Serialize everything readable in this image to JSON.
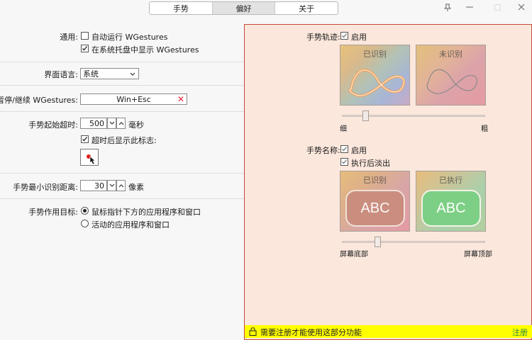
{
  "tabs": [
    {
      "label": "手势",
      "active": false
    },
    {
      "label": "偏好",
      "active": true
    },
    {
      "label": "关于",
      "active": false
    }
  ],
  "left": {
    "general_label": "通用:",
    "autorun_label": "自动运行 WGestures",
    "autorun_checked": false,
    "tray_label": "在系统托盘中显示 WGestures",
    "tray_checked": true,
    "language_label": "界面语言:",
    "language_value": "系统",
    "pause_label": "暂停/继续 WGestures:",
    "pause_hotkey": "Win+Esc",
    "timeout_label": "手势起始超时:",
    "timeout_value": "500",
    "timeout_unit": "毫秒",
    "show_marker_label": "超时后显示此标志:",
    "show_marker_checked": true,
    "min_distance_label": "手势最小识别距离:",
    "min_distance_value": "30",
    "min_distance_unit": "像素",
    "target_label": "手势作用目标:",
    "target_option1": "鼠标指针下方的应用程序和窗口",
    "target_option2": "活动的应用程序和窗口",
    "target_selected": 1
  },
  "right": {
    "trail_label": "手势轨迹:",
    "trail_enable": "启用",
    "trail_enabled": true,
    "recognized": "已识别",
    "unrecognized": "未识别",
    "thin": "细",
    "thick": "粗",
    "trail_width_fraction": 0.17,
    "name_label": "手势名称:",
    "name_enable": "启用",
    "name_enabled": true,
    "fade_label": "执行后淡出",
    "fade_checked": true,
    "executed": "已执行",
    "abc": "ABC",
    "screen_bottom": "屏幕底部",
    "screen_top": "屏幕顶部",
    "name_position_fraction": 0.25
  },
  "footer": {
    "message": "需要注册才能使用这部分功能",
    "register": "注册"
  },
  "colors": {
    "accent_border": "#c64a3d",
    "panel_bg": "#fbe7dc",
    "footer_bg": "#ffff00",
    "register_link": "#2a8a3c",
    "trail_recognized": "#f2a05a",
    "abc_recognized_bg": "#c98c7d",
    "abc_executed_bg": "#7ccf84"
  }
}
